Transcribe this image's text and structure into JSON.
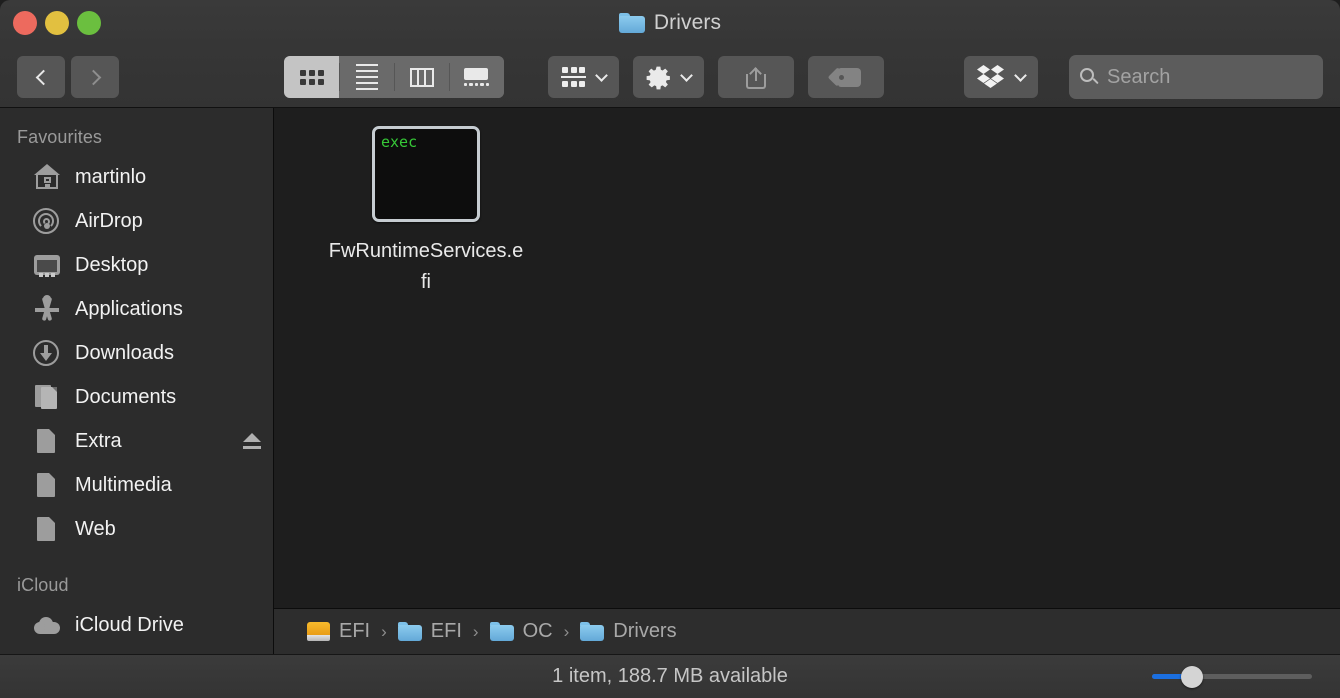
{
  "window": {
    "title": "Drivers",
    "title_icon": "folder-icon",
    "traffic_lights": [
      {
        "name": "close-button",
        "color": "#ed6a5e"
      },
      {
        "name": "minimize-button",
        "color": "#e2c040"
      },
      {
        "name": "maximize-button",
        "color": "#6bbf3f"
      }
    ]
  },
  "toolbar": {
    "back_label": "chevron-left-icon",
    "forward_label": "chevron-right-icon",
    "view_modes": [
      {
        "id": "icon-view",
        "icon": "grid-icon",
        "active": true
      },
      {
        "id": "list-view",
        "icon": "list-icon",
        "active": false
      },
      {
        "id": "column-view",
        "icon": "columns-icon",
        "active": false
      },
      {
        "id": "gallery-view",
        "icon": "gallery-icon",
        "active": false
      }
    ],
    "arrange_icon": "arrange-icon",
    "action_icon": "gear-icon",
    "share_icon": "share-icon",
    "tag_icon": "tag-icon",
    "dropbox_icon": "dropbox-icon"
  },
  "search": {
    "placeholder": "Search",
    "value": "",
    "icon": "search-icon"
  },
  "sidebar": {
    "sections": [
      {
        "header": "Favourites",
        "items": [
          {
            "label": "martinlo",
            "icon": "home-icon",
            "eject": false
          },
          {
            "label": "AirDrop",
            "icon": "airdrop-icon",
            "eject": false
          },
          {
            "label": "Desktop",
            "icon": "desktop-icon",
            "eject": false
          },
          {
            "label": "Applications",
            "icon": "apps-icon",
            "eject": false
          },
          {
            "label": "Downloads",
            "icon": "downloads-icon",
            "eject": false
          },
          {
            "label": "Documents",
            "icon": "documents-icon",
            "eject": false
          },
          {
            "label": "Extra",
            "icon": "file-icon",
            "eject": true
          },
          {
            "label": "Multimedia",
            "icon": "file-icon",
            "eject": false
          },
          {
            "label": "Web",
            "icon": "file-icon",
            "eject": false
          }
        ]
      },
      {
        "header": "iCloud",
        "items": [
          {
            "label": "iCloud Drive",
            "icon": "icloud-icon",
            "eject": false
          }
        ]
      }
    ]
  },
  "content": {
    "files": [
      {
        "name": "FwRuntimeServices.efi",
        "icon": "exec-icon",
        "icon_text": "exec",
        "selected": false
      }
    ]
  },
  "pathbar": {
    "crumbs": [
      {
        "label": "EFI",
        "icon": "drive-icon"
      },
      {
        "label": "EFI",
        "icon": "folder-icon"
      },
      {
        "label": "OC",
        "icon": "folder-icon"
      },
      {
        "label": "Drivers",
        "icon": "folder-icon"
      }
    ],
    "separator": "›"
  },
  "statusbar": {
    "text": "1 item, 188.7 MB available",
    "zoom_percent": 25
  }
}
